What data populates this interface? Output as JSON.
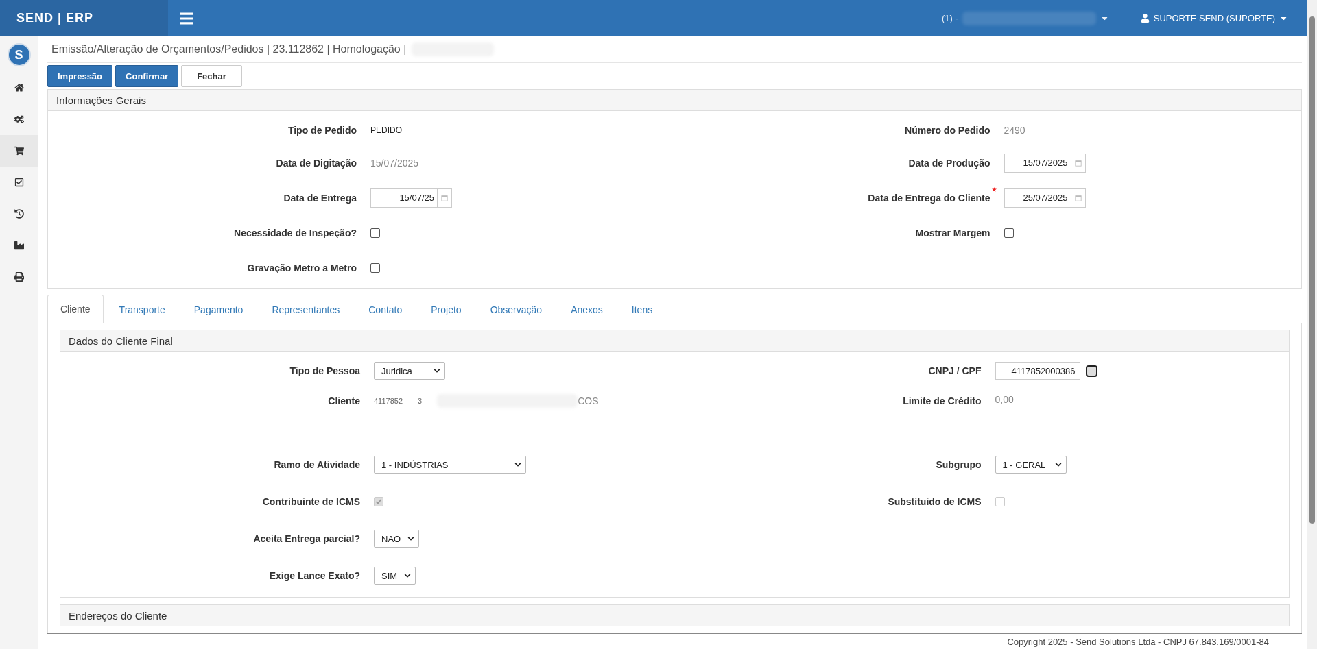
{
  "header": {
    "brand": "SEND | ERP",
    "company": "(1) -",
    "user": "SUPORTE SEND (SUPORTE)"
  },
  "sidebar": {
    "logo": "S",
    "items": [
      {
        "kind": "home",
        "selected": false
      },
      {
        "kind": "cogs",
        "selected": false
      },
      {
        "kind": "cart",
        "selected": true
      },
      {
        "kind": "check",
        "selected": false
      },
      {
        "kind": "history",
        "selected": false
      },
      {
        "kind": "industry",
        "selected": false
      },
      {
        "kind": "print",
        "selected": false
      }
    ]
  },
  "page_title": "Emissão/Alteração de Orçamentos/Pedidos | 23.112862 | Homologação |",
  "buttons": [
    {
      "label": "Impressão",
      "kind": "primary"
    },
    {
      "label": "Confirmar",
      "kind": "primary"
    },
    {
      "label": "Fechar",
      "kind": "default"
    }
  ],
  "general": {
    "title": "Informações Gerais",
    "rows": [
      {
        "left": {
          "kind": "plain",
          "label": "Tipo de Pedido",
          "value": "PEDIDO"
        },
        "right": {
          "kind": "muted",
          "label": "Número do Pedido",
          "value": "2490"
        }
      },
      {
        "left": {
          "kind": "muted",
          "label": "Data de Digitação",
          "value": "15/07/2025"
        },
        "right": {
          "kind": "date",
          "label": "Data de Produção",
          "value": "15/07/2025"
        }
      },
      {
        "left": {
          "kind": "date",
          "label": "Data de Entrega",
          "value": "15/07/25"
        },
        "right": {
          "kind": "date",
          "label": "Data de Entrega do Cliente",
          "value": "25/07/2025",
          "required": true
        }
      },
      {
        "left": {
          "kind": "checkbox",
          "label": "Necessidade de Inspeção?",
          "checked": false,
          "disabled": false
        },
        "right": {
          "kind": "checkbox",
          "label": "Mostrar Margem",
          "checked": false,
          "disabled": false
        }
      },
      {
        "left": {
          "kind": "checkbox",
          "label": "Gravação Metro a Metro",
          "checked": false,
          "disabled": false
        }
      }
    ]
  },
  "tabs": [
    {
      "label": "Cliente",
      "selected": true
    },
    {
      "label": "Transporte",
      "selected": false
    },
    {
      "label": "Pagamento",
      "selected": false
    },
    {
      "label": "Representantes",
      "selected": false
    },
    {
      "label": "Contato",
      "selected": false
    },
    {
      "label": "Projeto",
      "selected": false
    },
    {
      "label": "Observação",
      "selected": false
    },
    {
      "label": "Anexos",
      "selected": false
    },
    {
      "label": "Itens",
      "selected": false
    }
  ],
  "client_panel": {
    "title": "Dados do Cliente Final",
    "rows": [
      {
        "left": {
          "kind": "select",
          "label": "Tipo de Pessoa",
          "value": "Juridica"
        },
        "right": {
          "kind": "lookup",
          "label": "CNPJ / CPF",
          "value": "4117852000386"
        }
      },
      {
        "left": {
          "kind": "client",
          "label": "Cliente",
          "code": "4117852",
          "number": "3",
          "name_tail": "COS"
        },
        "right": {
          "kind": "muted",
          "label": "Limite de Crédito",
          "value": "0,00"
        }
      },
      {
        "left": {
          "kind": "select",
          "label": "Ramo de Atividade",
          "value": "1 - INDÚSTRIAS"
        },
        "right": {
          "kind": "select",
          "label": "Subgrupo",
          "value": "1 - GERAL"
        }
      },
      {
        "left": {
          "kind": "checkbox",
          "label": "Contribuinte de ICMS",
          "checked": true,
          "disabled": true
        },
        "right": {
          "kind": "checkbox",
          "label": "Substituido de ICMS",
          "checked": false,
          "disabled": true
        }
      },
      {
        "left": {
          "kind": "select",
          "label": "Aceita Entrega parcial?",
          "value": "NÃO"
        }
      },
      {
        "left": {
          "kind": "select",
          "label": "Exige Lance Exato?",
          "value": "SIM"
        }
      }
    ]
  },
  "address_panel": {
    "title": "Endereços do Cliente"
  },
  "footer": "Copyright 2025 - Send Solutions Ltda - CNPJ 67.843.169/0001-84"
}
